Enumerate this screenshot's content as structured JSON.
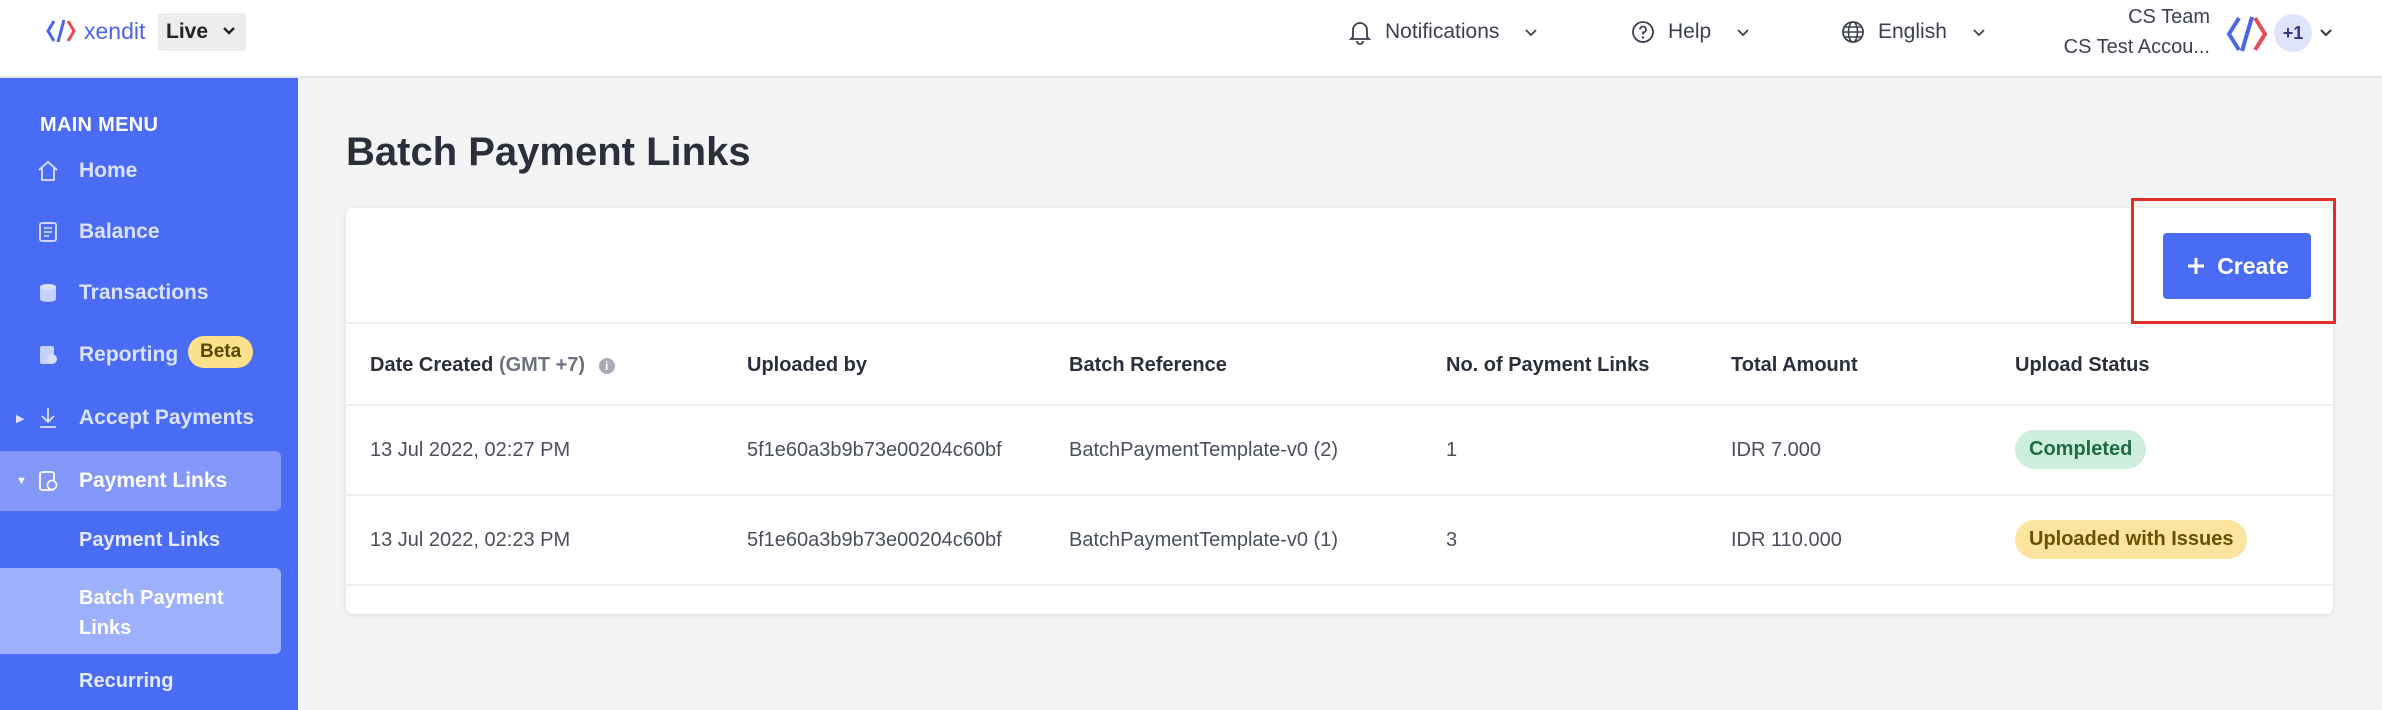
{
  "topbar": {
    "brand": "xendit",
    "environment": "Live",
    "notifications_label": "Notifications",
    "help_label": "Help",
    "language_label": "English",
    "account_name": "CS Team",
    "account_sub": "CS Test Accou...",
    "extra_accounts": "+1"
  },
  "sidebar": {
    "menu_title": "MAIN MENU",
    "items": [
      {
        "label": "Home",
        "icon": "home-icon"
      },
      {
        "label": "Balance",
        "icon": "balance-icon"
      },
      {
        "label": "Transactions",
        "icon": "transactions-icon"
      },
      {
        "label": "Reporting",
        "icon": "reporting-icon",
        "badge": "Beta"
      },
      {
        "label": "Accept Payments",
        "icon": "accept-payments-icon"
      },
      {
        "label": "Payment Links",
        "icon": "payment-links-icon"
      }
    ],
    "sub_items": [
      {
        "label": "Payment Links"
      },
      {
        "label": "Batch Payment",
        "label2": "Links"
      },
      {
        "label": "Recurring"
      }
    ]
  },
  "main": {
    "title": "Batch Payment Links",
    "create_label": "Create",
    "columns": [
      "Date Created",
      "(GMT +7)",
      "Uploaded by",
      "Batch Reference",
      "No. of Payment Links",
      "Total Amount",
      "Upload Status"
    ],
    "rows": [
      {
        "date": "13 Jul 2022, 02:27 PM",
        "uploaded_by": "5f1e60a3b9b73e00204c60bf",
        "batch_ref": "BatchPaymentTemplate-v0 (2)",
        "count": "1",
        "amount": "IDR 7.000",
        "status": "Completed"
      },
      {
        "date": "13 Jul 2022, 02:23 PM",
        "uploaded_by": "5f1e60a3b9b73e00204c60bf",
        "batch_ref": "BatchPaymentTemplate-v0 (1)",
        "count": "3",
        "amount": "IDR 110.000",
        "status": "Uploaded with Issues"
      }
    ]
  },
  "colors": {
    "brand": "#4a6cf4",
    "status_completed": "#cdeedd",
    "status_issues": "#fbe3a0",
    "highlight": "#e0302a"
  }
}
